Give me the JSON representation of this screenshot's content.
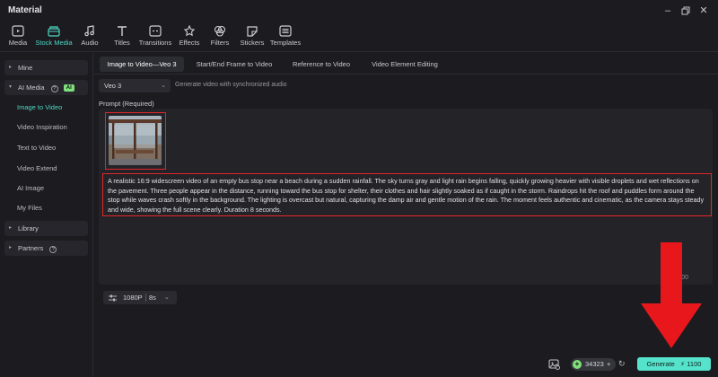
{
  "window": {
    "title": "Material"
  },
  "toolbar": {
    "items": [
      {
        "label": "Media",
        "icon": "media-icon"
      },
      {
        "label": "Stock Media",
        "icon": "stock-media-icon",
        "active": true
      },
      {
        "label": "Audio",
        "icon": "audio-icon"
      },
      {
        "label": "Titles",
        "icon": "titles-icon"
      },
      {
        "label": "Transitions",
        "icon": "transitions-icon"
      },
      {
        "label": "Effects",
        "icon": "effects-icon"
      },
      {
        "label": "Filters",
        "icon": "filters-icon"
      },
      {
        "label": "Stickers",
        "icon": "stickers-icon"
      },
      {
        "label": "Templates",
        "icon": "templates-icon"
      }
    ]
  },
  "sidebar": {
    "mine": "Mine",
    "ai_media": "AI Media",
    "ai_badge": "AI",
    "items": [
      "Image to Video",
      "Video Inspiration",
      "Text to Video",
      "Video Extend",
      "AI Image",
      "My Files"
    ],
    "library": "Library",
    "partners": "Partners"
  },
  "tabs": [
    "Image to Video—Veo 3",
    "Start/End Frame to Video",
    "Reference to Video",
    "Video Element Editing"
  ],
  "model": {
    "selected": "Veo 3",
    "description": "Generate video with synchronized audio"
  },
  "prompt": {
    "label": "Prompt (Required)",
    "text": "A realistic 16:9 widescreen video of an empty bus stop near a beach during a sudden rainfall. The sky turns gray and light rain begins falling, quickly growing heavier with visible droplets and wet reflections on the pavement. Three people appear in the distance, running toward the bus stop for shelter, their clothes and hair slightly soaked as if caught in the storm. Raindrops hit the roof and puddles form around the stop while waves crash softly in the background. The lighting is overcast but natural, capturing the damp air and gentle motion of the rain. The moment feels authentic and cinematic, as the camera stays steady and wide, showing the full scene clearly. Duration 8 seconds.",
    "count": "693/1500"
  },
  "settings": {
    "resolution": "1080P",
    "duration": "8s"
  },
  "footer": {
    "credits": "34323",
    "generate_label": "Generate",
    "generate_cost": "1100"
  },
  "colors": {
    "accent": "#4fd6c4",
    "generate": "#55e3cc",
    "highlight": "#e0262b",
    "ai_badge": "#7fdf7a"
  }
}
